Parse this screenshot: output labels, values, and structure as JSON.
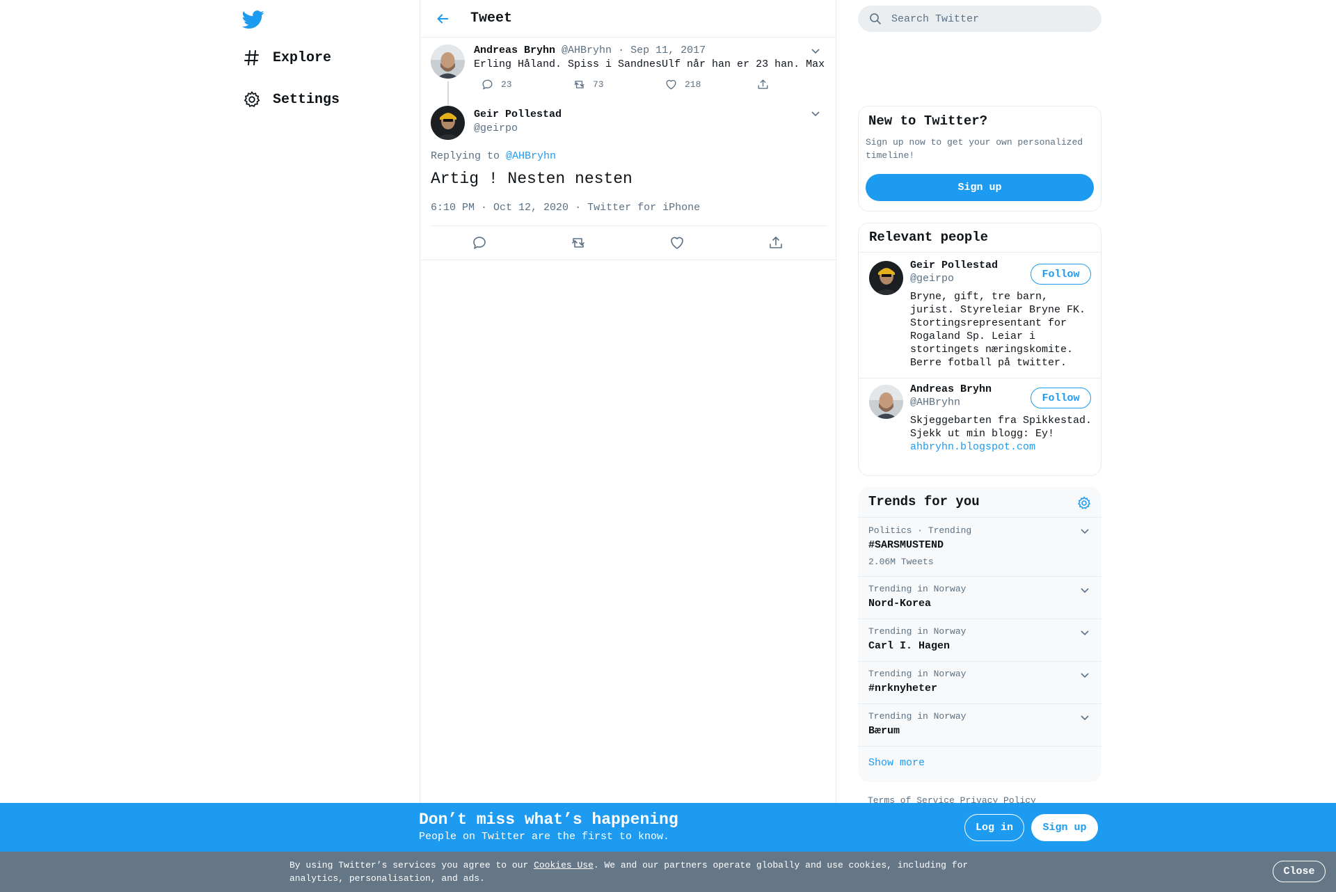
{
  "nav": {
    "logo_icon": "twitter-bird-icon",
    "items": [
      {
        "label": "Explore",
        "icon": "hashtag-icon"
      },
      {
        "label": "Settings",
        "icon": "gear-icon"
      }
    ]
  },
  "header": {
    "title": "Tweet"
  },
  "parent_tweet": {
    "name": "Andreas Bryhn",
    "handle": "@AHBryhn",
    "date": "· Sep 11, 2017",
    "text": "Erling Håland. Spiss i SandnesUlf når han er 23 han. Max",
    "replies": "23",
    "retweets": "73",
    "likes": "218"
  },
  "main_tweet": {
    "name": "Geir Pollestad",
    "handle": "@geirpo",
    "replying_to_label": "Replying to",
    "replying_to_handle": "@AHBryhn",
    "text": "Artig ! Nesten nesten",
    "timestamp": "6:10 PM · Oct 12, 2020",
    "source": "· Twitter for iPhone"
  },
  "search": {
    "placeholder": "Search Twitter"
  },
  "new_to_twitter": {
    "title": "New to Twitter?",
    "text": "Sign up now to get your own personalized timeline!",
    "button": "Sign up"
  },
  "relevant_people": {
    "title": "Relevant people",
    "people": [
      {
        "name": "Geir Pollestad",
        "handle": "@geirpo",
        "bio": "Bryne, gift, tre barn, jurist. Styreleiar Bryne FK. Stortingsrepresentant for Rogaland Sp. Leiar i stortingets næringskomite. Berre fotball på twitter.",
        "link": "",
        "follow": "Follow"
      },
      {
        "name": "Andreas Bryhn",
        "handle": "@AHBryhn",
        "bio": "Skjeggebarten fra Spikkestad. Sjekk ut min blogg: Ey!",
        "link": "ahbryhn.blogspot.com",
        "follow": "Follow"
      }
    ]
  },
  "trends": {
    "title": "Trends for you",
    "items": [
      {
        "context": "Politics · Trending",
        "name": "#SARSMUSTEND",
        "count": "2.06M Tweets"
      },
      {
        "context": "Trending in Norway",
        "name": "Nord-Korea",
        "count": ""
      },
      {
        "context": "Trending in Norway",
        "name": "Carl I. Hagen",
        "count": ""
      },
      {
        "context": "Trending in Norway",
        "name": "#nrknyheter",
        "count": ""
      },
      {
        "context": "Trending in Norway",
        "name": "Bærum",
        "count": ""
      }
    ],
    "show_more": "Show more"
  },
  "footer": {
    "terms": "Terms of Service",
    "privacy": "Privacy Policy"
  },
  "promo": {
    "title": "Don’t miss what’s happening",
    "subtitle": "People on Twitter are the first to know.",
    "login": "Log in",
    "signup": "Sign up"
  },
  "cookie": {
    "text_before": "By using Twitter’s services you agree to our ",
    "link": "Cookies Use",
    "text_after": ". We and our partners operate globally and use cookies, including for analytics, personalisation, and ads.",
    "close": "Close"
  },
  "colors": {
    "accent": "#1d9bf0",
    "muted": "#5b7083",
    "cookie_bg": "#657786"
  }
}
